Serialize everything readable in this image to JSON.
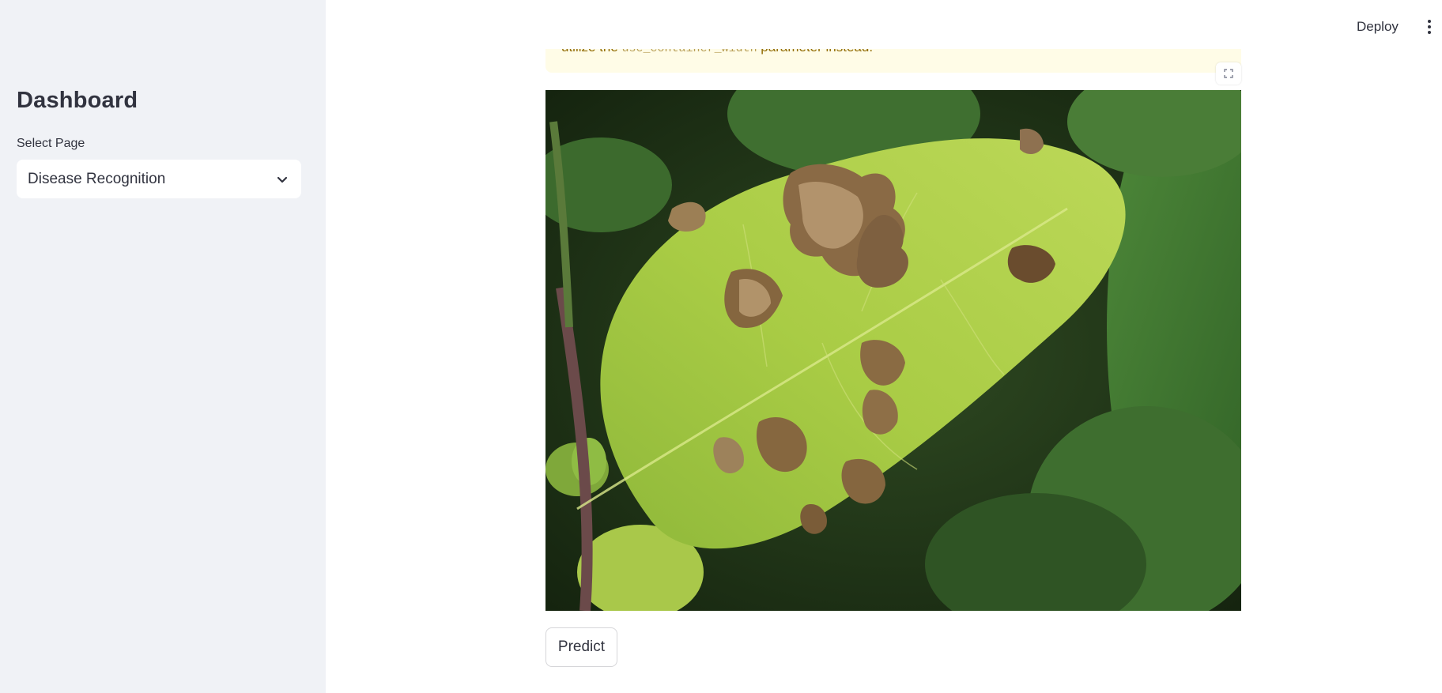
{
  "sidebar": {
    "title": "Dashboard",
    "select_label": "Select Page",
    "select_value": "Disease Recognition"
  },
  "header": {
    "deploy_label": "Deploy"
  },
  "warning": {
    "text_prefix": "utilize the ",
    "code": "use_container_width",
    "text_suffix": " parameter instead."
  },
  "main": {
    "predict_label": "Predict"
  },
  "colors": {
    "sidebar_bg": "#f0f2f6",
    "warning_bg": "#fffce7",
    "warning_text": "#926c05",
    "text": "#31333f"
  }
}
